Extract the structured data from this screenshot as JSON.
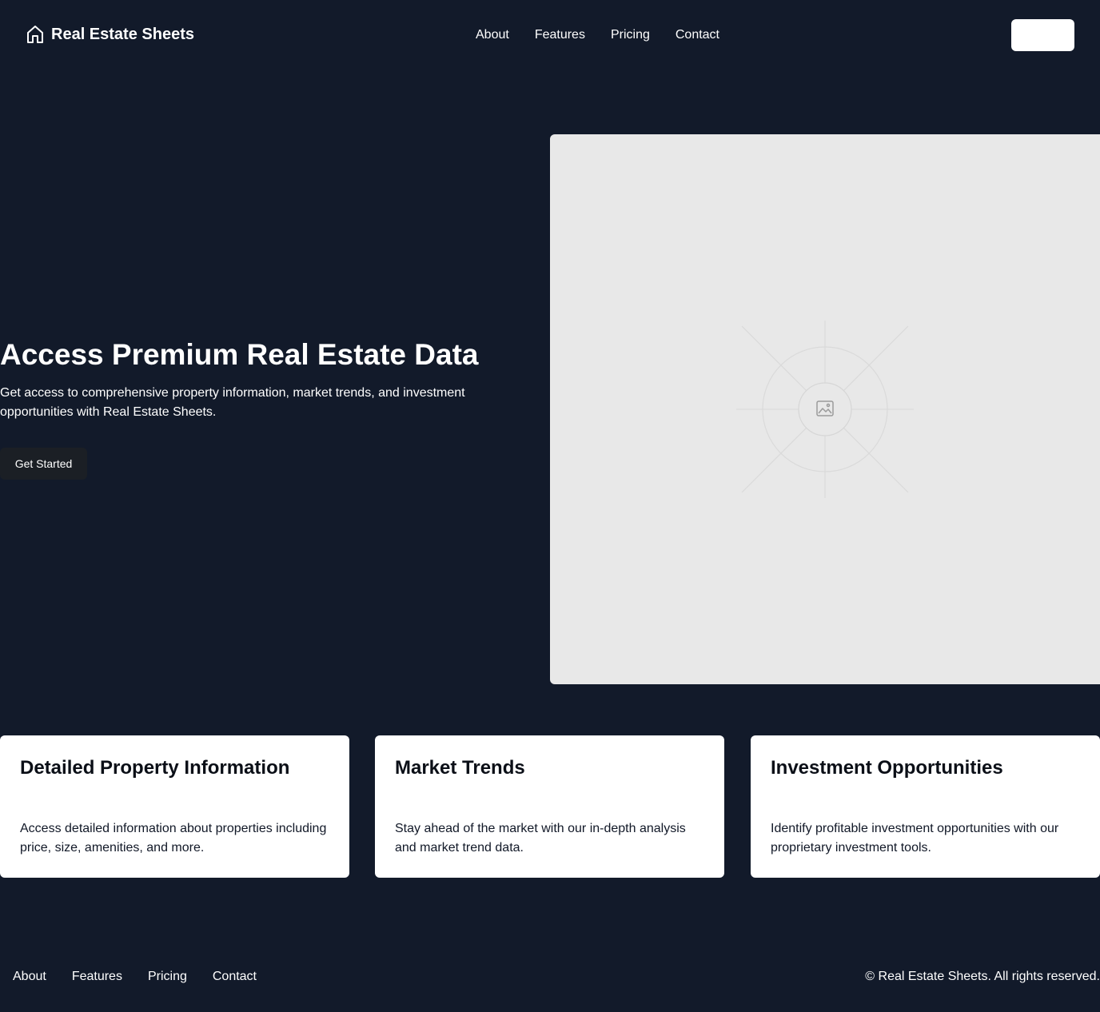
{
  "brand": {
    "name": "Real Estate Sheets",
    "icon": "home-icon"
  },
  "nav": {
    "items": [
      "About",
      "Features",
      "Pricing",
      "Contact"
    ]
  },
  "header_button": {
    "label": ""
  },
  "hero": {
    "title": "Access Premium Real Estate Data",
    "subtitle": "Get access to comprehensive property information, market trends, and investment opportunities with Real Estate Sheets.",
    "cta_label": "Get Started",
    "image_icon": "image-placeholder-icon"
  },
  "features": [
    {
      "title": "Detailed Property Information",
      "description": "Access detailed information about properties including price, size, amenities, and more."
    },
    {
      "title": "Market Trends",
      "description": "Stay ahead of the market with our in-depth analysis and market trend data."
    },
    {
      "title": "Investment Opportunities",
      "description": "Identify profitable investment opportunities with our proprietary investment tools."
    }
  ],
  "footer": {
    "nav": [
      "About",
      "Features",
      "Pricing",
      "Contact"
    ],
    "copyright": "© Real Estate Sheets. All rights reserved."
  },
  "colors": {
    "background": "#121a2a",
    "card": "#ffffff",
    "placeholder": "#e8e8e8",
    "cta": "#1b1f25"
  }
}
